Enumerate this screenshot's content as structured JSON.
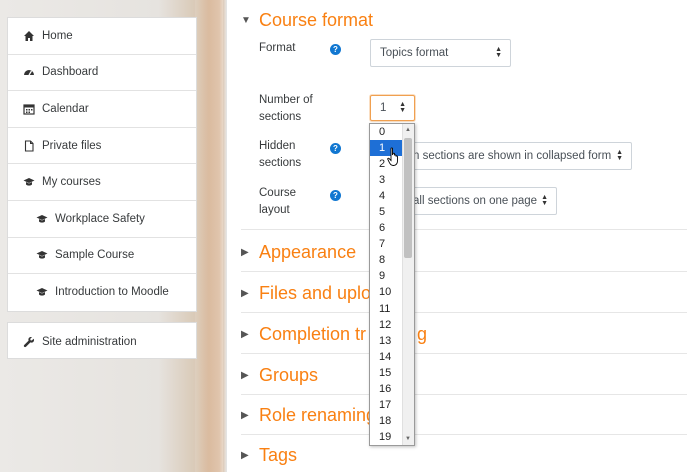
{
  "nav": {
    "items": [
      {
        "label": "Home",
        "icon": "home-icon"
      },
      {
        "label": "Dashboard",
        "icon": "dashboard-icon"
      },
      {
        "label": "Calendar",
        "icon": "calendar-icon"
      },
      {
        "label": "Private files",
        "icon": "file-icon"
      },
      {
        "label": "My courses",
        "icon": "graduation-cap-icon"
      },
      {
        "label": "Workplace Safety",
        "icon": "graduation-cap-icon"
      },
      {
        "label": "Sample Course",
        "icon": "graduation-cap-icon"
      },
      {
        "label": "Introduction to Moodle",
        "icon": "graduation-cap-icon"
      }
    ],
    "site_admin": "Site administration"
  },
  "course_format": {
    "title": "Course format",
    "format_label": "Format",
    "format_value": "Topics format",
    "sections_label_1": "Number of",
    "sections_label_2": "sections",
    "sections_value": "1",
    "hidden_label_1": "Hidden",
    "hidden_label_2": "sections",
    "hidden_value": "n sections are shown in collapsed form",
    "layout_label_1": "Course",
    "layout_label_2": "layout",
    "layout_value": "all sections on one page"
  },
  "sections": [
    {
      "title": "Appearance"
    },
    {
      "title": "Files and uplo"
    },
    {
      "title": "Completion tr"
    },
    {
      "title": "Groups"
    },
    {
      "title": "Role renaming"
    },
    {
      "title": "Tags"
    }
  ],
  "section_tails": {
    "completion": "g"
  },
  "dropdown": {
    "options": [
      "0",
      "1",
      "2",
      "3",
      "4",
      "5",
      "6",
      "7",
      "8",
      "9",
      "10",
      "11",
      "12",
      "13",
      "14",
      "15",
      "16",
      "17",
      "18",
      "19"
    ],
    "selected": "1"
  },
  "colors": {
    "accent": "#f98012",
    "help": "#1177d1",
    "selected": "#1e6fd6"
  }
}
